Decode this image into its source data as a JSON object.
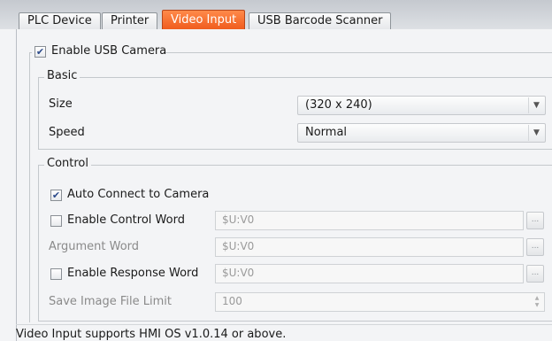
{
  "tabs": [
    {
      "label": "PLC Device",
      "active": false
    },
    {
      "label": "Printer",
      "active": false
    },
    {
      "label": "Video Input",
      "active": true
    },
    {
      "label": "USB Barcode Scanner",
      "active": false
    }
  ],
  "enable_camera": {
    "label": "Enable USB Camera",
    "checked": true
  },
  "basic": {
    "legend": "Basic",
    "size": {
      "label": "Size",
      "value": "(320 x 240)"
    },
    "speed": {
      "label": "Speed",
      "value": "Normal"
    }
  },
  "control": {
    "legend": "Control",
    "auto_connect": {
      "label": "Auto Connect to Camera",
      "checked": true
    },
    "control_word": {
      "label": "Enable Control Word",
      "checked": false,
      "value": "$U:V0",
      "browse": "..."
    },
    "argument_word": {
      "label": "Argument Word",
      "value": "$U:V0",
      "browse": "..."
    },
    "response_word": {
      "label": "Enable Response Word",
      "checked": false,
      "value": "$U:V0",
      "browse": "..."
    },
    "file_limit": {
      "label": "Save Image File Limit",
      "value": "100"
    }
  },
  "footer": "Video Input supports HMI OS v1.0.14 or above.",
  "icons": {
    "check": "✔",
    "dropdown": "▼",
    "spin_up": "▲",
    "spin_down": "▼"
  },
  "colors": {
    "active_tab": "#ef5a1c",
    "disabled_text": "#8a8a8a"
  }
}
